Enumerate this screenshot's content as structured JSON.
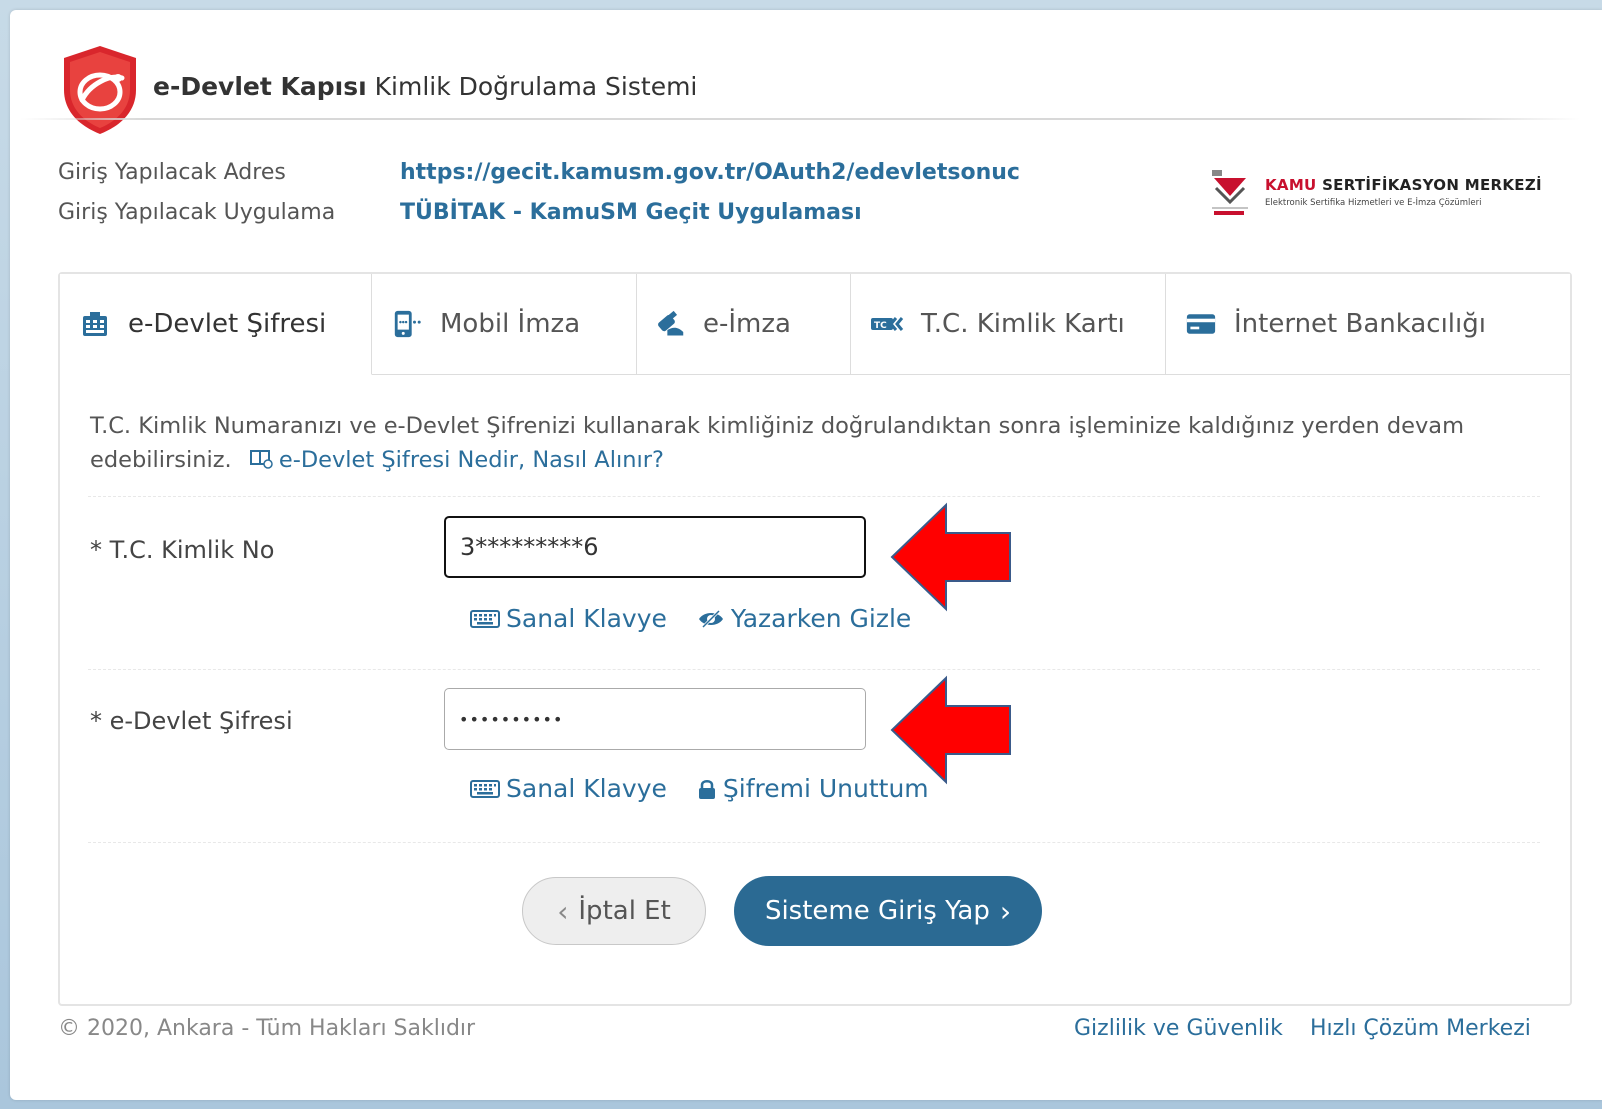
{
  "header": {
    "title_bold": "e-Devlet Kapısı",
    "title_rest": "Kimlik Doğrulama Sistemi"
  },
  "info": {
    "address_label": "Giriş Yapılacak Adres",
    "address_value": "https://gecit.kamusm.gov.tr/OAuth2/edevletsonuc",
    "app_label": "Giriş Yapılacak Uygulama",
    "app_value": "TÜBİTAK - KamuSM Geçit Uygulaması"
  },
  "kamusm": {
    "title_red": "KAMU",
    "title_rest": "SERTİFİKASYON MERKEZİ",
    "subtitle": "Elektronik Sertifika Hizmetleri ve E-İmza Çözümleri"
  },
  "tabs": [
    {
      "label": "e-Devlet Şifresi",
      "icon": "keypad-icon"
    },
    {
      "label": "Mobil İmza",
      "icon": "mobile-signature-icon"
    },
    {
      "label": "e-İmza",
      "icon": "usb-token-icon"
    },
    {
      "label": "T.C. Kimlik Kartı",
      "icon": "id-card-icon"
    },
    {
      "label": "İnternet Bankacılığı",
      "icon": "credit-card-icon"
    }
  ],
  "description": {
    "text": "T.C. Kimlik Numaranızı ve e-Devlet Şifrenizi kullanarak kimliğiniz doğrulandıktan sonra işleminize kaldığınız yerden devam edebilirsiniz.",
    "help_link": "e-Devlet Şifresi Nedir, Nasıl Alınır?"
  },
  "form": {
    "tc_label": "* T.C. Kimlik No",
    "tc_value": "3*********6",
    "virtual_keyboard": "Sanal Klavye",
    "hide_while_typing": "Yazarken Gizle",
    "password_label": "* e-Devlet Şifresi",
    "password_value": "••••••••••",
    "forgot_password": "Şifremi Unuttum"
  },
  "buttons": {
    "cancel": "İptal Et",
    "login": "Sisteme Giriş Yap"
  },
  "footer": {
    "copyright": "© 2020, Ankara - Tüm Hakları Saklıdır",
    "privacy": "Gizlilik ve Güvenlik",
    "help_center": "Hızlı Çözüm Merkezi"
  },
  "colors": {
    "link_blue": "#2b6e9b",
    "button_blue": "#2b6a93",
    "annotation_arrow": "#ff0000"
  }
}
